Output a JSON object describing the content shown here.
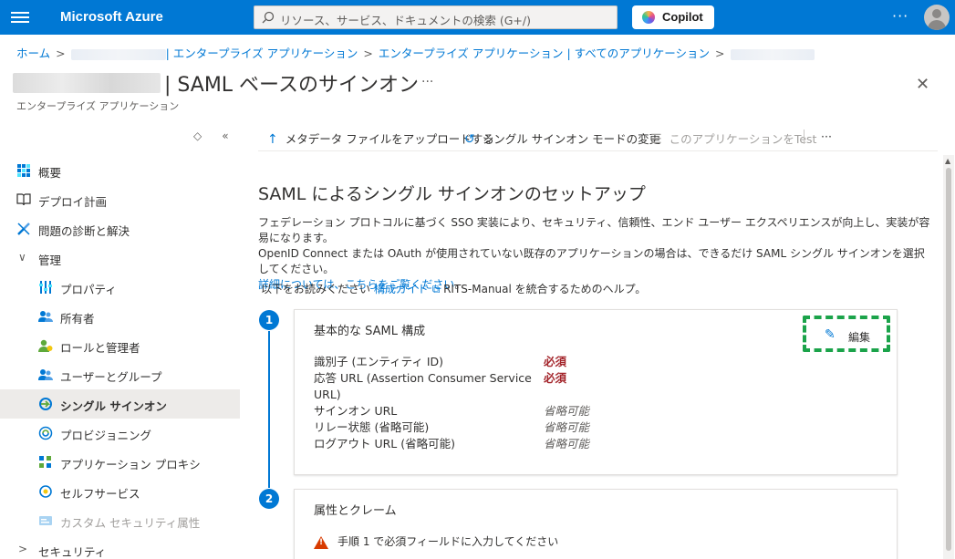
{
  "topbar": {
    "brand": "Microsoft Azure",
    "search_placeholder": "リソース、サービス、ドキュメントの検索 (G+/)",
    "copilot_label": "Copilot",
    "more": "···"
  },
  "breadcrumb": {
    "home": "ホーム",
    "item2": "| エンタープライズ アプリケーション",
    "item3": "エンタープライズ アプリケーション | すべてのアプリケーション"
  },
  "header": {
    "title": "| SAML ベースのサインオン",
    "more": "···",
    "subtitle": "エンタープライズ アプリケーション",
    "close": "✕"
  },
  "sidebar": {
    "tools": {
      "sort": "◇",
      "collapse": "«"
    },
    "items": [
      {
        "label": "概要"
      },
      {
        "label": "デプロイ計画"
      },
      {
        "label": "問題の診断と解決"
      },
      {
        "label": "管理",
        "chevron": "∨"
      },
      {
        "label": "プロパティ"
      },
      {
        "label": "所有者"
      },
      {
        "label": "ロールと管理者"
      },
      {
        "label": "ユーザーとグループ"
      },
      {
        "label": "シングル サインオン"
      },
      {
        "label": "プロビジョニング"
      },
      {
        "label": "アプリケーション プロキシ"
      },
      {
        "label": "セルフサービス"
      },
      {
        "label": "カスタム セキュリティ属性"
      },
      {
        "label": "セキュリティ",
        "chevron": ">"
      }
    ]
  },
  "commands": {
    "upload": "メタデータ ファイルをアップロードする",
    "change_mode": "シングル サインオン モードの変更",
    "test": "このアプリケーションをTest",
    "more": "···"
  },
  "main": {
    "title": "SAML によるシングル サインオンのセットアップ",
    "desc1": "フェデレーション プロトコルに基づく SSO 実装により、セキュリティ、信頼性、エンド ユーザー エクスペリエンスが向上し、実装が容易になります。",
    "desc2": "OpenID Connect または OAuth が使用されていない既存のアプリケーションの場合は、できるだけ SAML シングル サインオンを選択してください。",
    "desc3": "詳細については、こちらをご覧ください",
    "desc3_end": "。",
    "help_prefix": "以下をお読みください",
    "help_link": "構成ガイド",
    "help_suffix": "RITS-Manual を統合するためのヘルプ。"
  },
  "step1": {
    "number": "1",
    "title": "基本的な SAML 構成",
    "edit_label": "編集",
    "fields": [
      {
        "key": "識別子 (エンティティ ID)",
        "value": "必須",
        "kind": "req"
      },
      {
        "key": "応答 URL (Assertion Consumer Service URL)",
        "value": "必須",
        "kind": "req"
      },
      {
        "key": "サインオン URL",
        "value": "省略可能",
        "kind": "opt"
      },
      {
        "key": "リレー状態 (省略可能)",
        "value": "省略可能",
        "kind": "opt"
      },
      {
        "key": "ログアウト URL (省略可能)",
        "value": "省略可能",
        "kind": "opt"
      }
    ]
  },
  "step2": {
    "number": "2",
    "title": "属性とクレーム",
    "warning": "手順 1 で必須フィールドに入力してください"
  },
  "colors": {
    "accent": "#0078d4",
    "required": "#a4262c",
    "highlight": "#1ba34a",
    "warning": "#d83b01"
  }
}
